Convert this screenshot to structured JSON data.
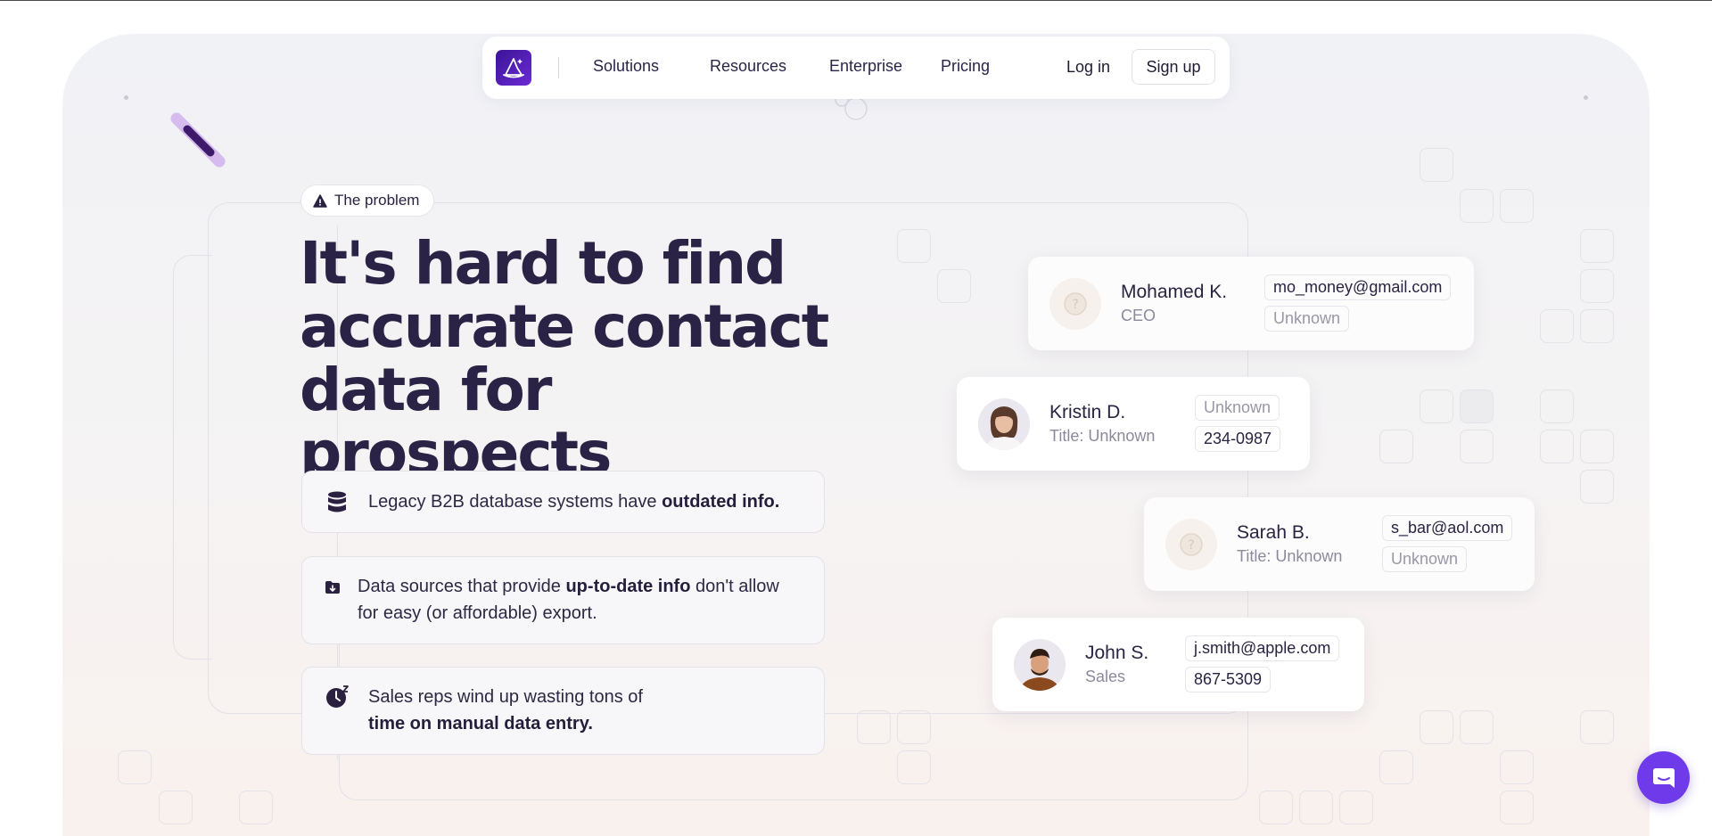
{
  "colors": {
    "brand": "#5b22c9",
    "brand_dark": "#3b1496",
    "headline": "#2b2345",
    "chat_button": "#6f3bea",
    "muted_text": "#8d899c"
  },
  "nav": {
    "logo_icon": "wizard-hat-icon",
    "items": [
      {
        "label": "Solutions"
      },
      {
        "label": "Resources"
      },
      {
        "label": "Enterprise"
      },
      {
        "label": "Pricing"
      }
    ],
    "login_label": "Log in",
    "signup_label": "Sign up"
  },
  "hero": {
    "badge_icon": "warning-triangle-icon",
    "badge_label": "The problem",
    "headline": "It's hard to find accurate contact data for prospects",
    "problems": [
      {
        "icon": "database-icon",
        "text_before": "Legacy B2B database systems have ",
        "text_bold": "outdated info.",
        "text_after": ""
      },
      {
        "icon": "folder-download-icon",
        "text_before": "Data sources that provide ",
        "text_bold": "up-to-date info",
        "text_after": " don't allow for easy (or affordable) export."
      },
      {
        "icon": "clock-sleep-icon",
        "text_before": "Sales reps wind up wasting tons of ",
        "text_bold": "time on manual data entry.",
        "text_after": ""
      }
    ]
  },
  "contacts": [
    {
      "name": "Mohamed K.",
      "title": "CEO",
      "field1": "mo_money@gmail.com",
      "field2": "Unknown",
      "avatar": "unknown-avatar-icon"
    },
    {
      "name": "Kristin D.",
      "title": "Title: Unknown",
      "field1": "Unknown",
      "field2": "234-0987",
      "avatar": "woman-avatar"
    },
    {
      "name": "Sarah B.",
      "title": "Title: Unknown",
      "field1": "s_bar@aol.com",
      "field2": "Unknown",
      "avatar": "unknown-avatar-icon"
    },
    {
      "name": "John S.",
      "title": "Sales",
      "field1": "j.smith@apple.com",
      "field2": "867-5309",
      "avatar": "man-avatar"
    }
  ],
  "chat_widget": {
    "icon": "chat-bubble-icon"
  }
}
